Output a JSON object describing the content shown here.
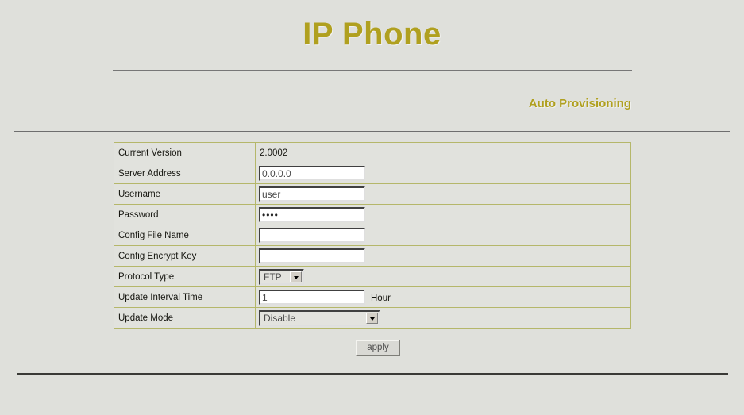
{
  "header": {
    "title": "IP Phone",
    "section_title": "Auto Provisioning",
    "title_color": "#b0a01f"
  },
  "form": {
    "rows": [
      {
        "label": "Current Version",
        "type": "static",
        "value": "2.0002"
      },
      {
        "label": "Server Address",
        "type": "text",
        "value": "0.0.0.0"
      },
      {
        "label": "Username",
        "type": "text",
        "value": "user"
      },
      {
        "label": "Password",
        "type": "password",
        "value": "••••"
      },
      {
        "label": "Config File Name",
        "type": "text",
        "value": ""
      },
      {
        "label": "Config Encrypt Key",
        "type": "text",
        "value": ""
      },
      {
        "label": "Protocol Type",
        "type": "select",
        "value": "FTP"
      },
      {
        "label": "Update Interval Time",
        "type": "text",
        "value": "1",
        "unit": "Hour"
      },
      {
        "label": "Update Mode",
        "type": "select",
        "value": "Disable"
      }
    ]
  },
  "actions": {
    "apply_label": "apply"
  }
}
